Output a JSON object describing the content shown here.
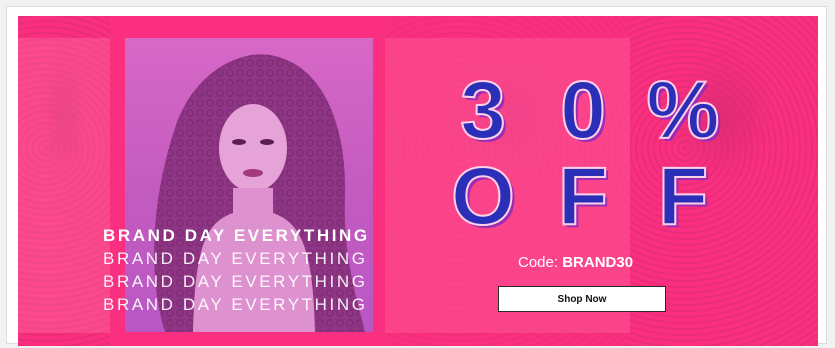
{
  "banner": {
    "headline_rows": [
      [
        "3",
        "0",
        "%"
      ],
      [
        "O",
        "F",
        "F"
      ]
    ],
    "brand_lines": [
      "BRAND DAY EVERYTHING",
      "BRAND DAY EVERYTHING",
      "BRAND DAY EVERYTHING",
      "BRAND DAY EVERYTHING"
    ],
    "code_label": "Code:",
    "code_value": "BRAND30",
    "cta_label": "Shop Now"
  },
  "colors": {
    "banner_bg": "#fb2f7f",
    "headline": "#2b2fb8",
    "photo_tint": "#c25bbf",
    "button_bg": "#ffffff"
  }
}
